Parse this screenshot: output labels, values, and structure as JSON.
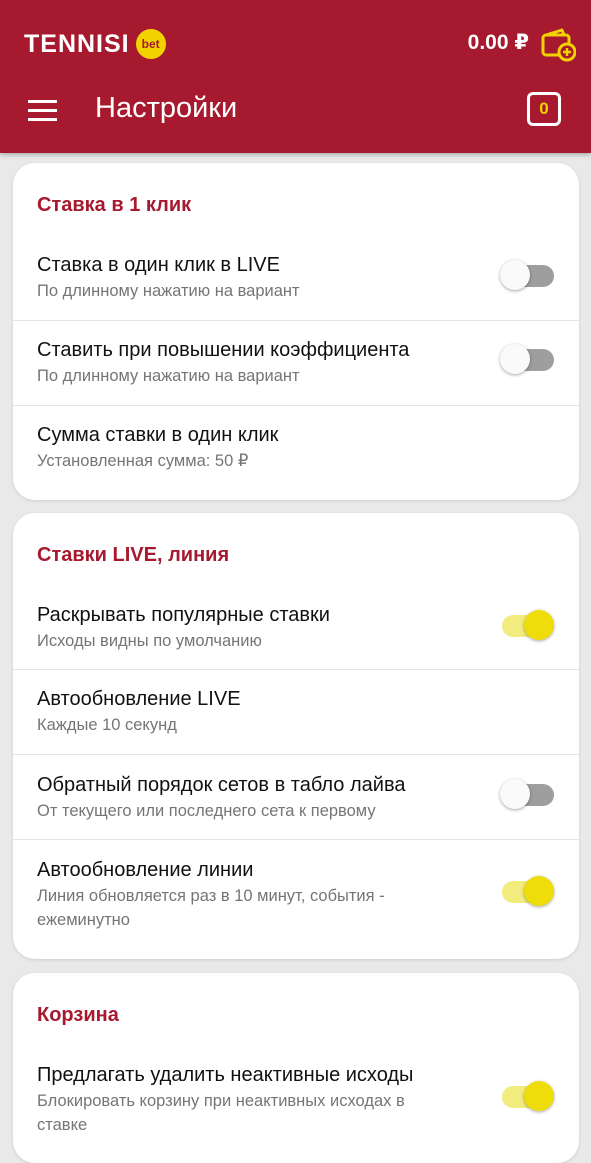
{
  "header": {
    "logo_text": "TENNISI",
    "logo_badge": "bet",
    "balance": "0.00 ₽",
    "title": "Настройки",
    "coupon_count": "0"
  },
  "colors": {
    "brand": "#a6192e",
    "accent": "#efdd0a"
  },
  "icons": [
    "menu-icon",
    "wallet-add-icon",
    "coupon-icon"
  ],
  "sections": [
    {
      "title": "Ставка в 1 клик",
      "items": [
        {
          "title": "Ставка в один клик в LIVE",
          "subtitle": "По длинному нажатию на вариант",
          "toggle": false
        },
        {
          "title": "Ставить при повышении коэффициента",
          "subtitle": "По длинному нажатию на вариант",
          "toggle": false
        },
        {
          "title": "Сумма ставки в один клик",
          "subtitle": "Установленная сумма: 50 ₽"
        }
      ]
    },
    {
      "title": "Ставки LIVE, линия",
      "items": [
        {
          "title": "Раскрывать популярные ставки",
          "subtitle": "Исходы видны по умолчанию",
          "toggle": true
        },
        {
          "title": "Автообновление LIVE",
          "subtitle": "Каждые 10 секунд"
        },
        {
          "title": "Обратный порядок сетов в табло лайва",
          "subtitle": "От текущего или последнего сета к первому",
          "toggle": false
        },
        {
          "title": "Автообновление линии",
          "subtitle": "Линия обновляется раз в 10 минут, события - ежеминутно",
          "toggle": true
        }
      ]
    },
    {
      "title": "Корзина",
      "items": [
        {
          "title": "Предлагать удалить неактивные исходы",
          "subtitle": "Блокировать корзину при неактивных исходах в ставке",
          "toggle": true
        }
      ]
    }
  ]
}
